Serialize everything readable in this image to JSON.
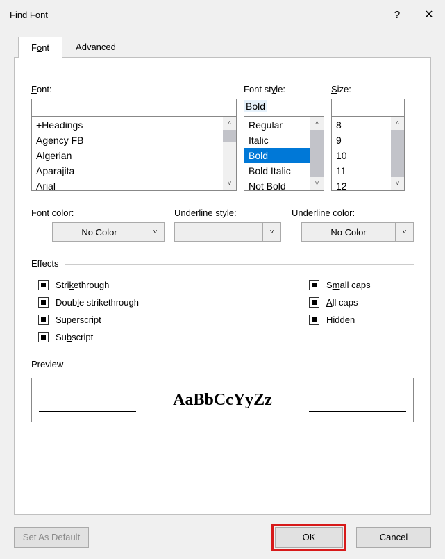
{
  "title": "Find Font",
  "tabs": {
    "font": "Font",
    "advanced": "Advanced",
    "font_accel": "o",
    "adv_accel": "v"
  },
  "labels": {
    "font": "Font:",
    "font_accel": "F",
    "style": "Font style:",
    "style_accel": "y",
    "size": "Size:",
    "size_accel": "S",
    "fontcolor": "Font color:",
    "fontcolor_accel": "c",
    "ustyle": "Underline style:",
    "ustyle_accel": "U",
    "ucolor": "Underline color:",
    "ucolor_accel": "n",
    "effects": "Effects",
    "preview": "Preview"
  },
  "inputs": {
    "font": "",
    "style": "Bold",
    "size": ""
  },
  "fonts": [
    "+Headings",
    "Agency FB",
    "Algerian",
    "Aparajita",
    "Arial"
  ],
  "styles": [
    "Regular",
    "Italic",
    "Bold",
    "Bold Italic",
    "Not Bold"
  ],
  "styles_selected_index": 2,
  "sizes": [
    "8",
    "9",
    "10",
    "11",
    "12"
  ],
  "dropdowns": {
    "fontcolor": "No Color",
    "ustyle": "",
    "ucolor": "No Color"
  },
  "effects": {
    "strike": "Strikethrough",
    "strike_accel": "k",
    "dstrike": "Double strikethrough",
    "dstrike_accel": "l",
    "super": "Superscript",
    "super_accel": "p",
    "sub": "Subscript",
    "sub_accel": "b",
    "smallcaps": "Small caps",
    "smallcaps_accel": "m",
    "allcaps": "All caps",
    "allcaps_accel": "A",
    "hidden": "Hidden",
    "hidden_accel": "H"
  },
  "preview_text": "AaBbCcYyZz",
  "buttons": {
    "default": "Set As Default",
    "ok": "OK",
    "cancel": "Cancel"
  }
}
